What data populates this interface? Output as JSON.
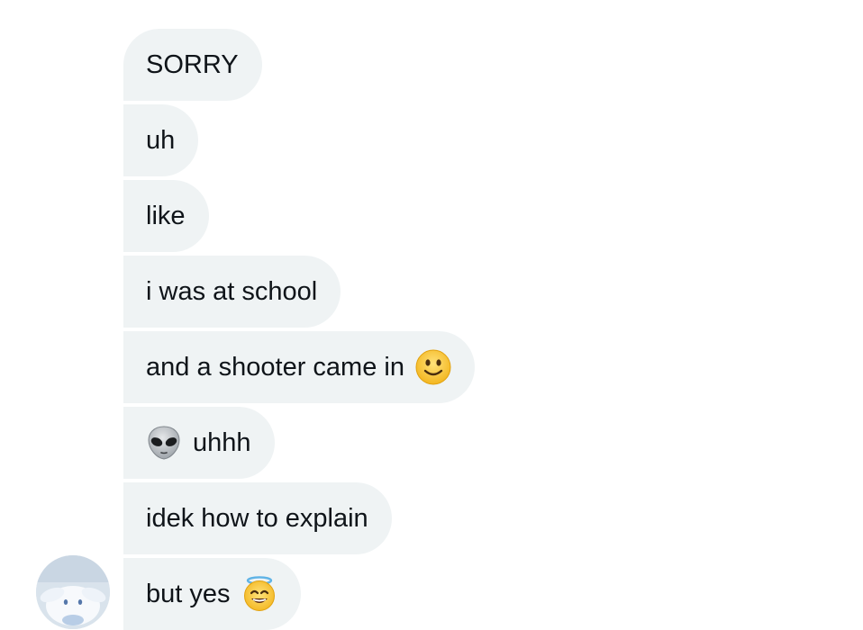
{
  "conversation": {
    "messages": [
      {
        "text": "SORRY",
        "emoji_before": "",
        "emoji_after": ""
      },
      {
        "text": "uh",
        "emoji_before": "",
        "emoji_after": ""
      },
      {
        "text": "like",
        "emoji_before": "",
        "emoji_after": ""
      },
      {
        "text": "i was at school",
        "emoji_before": "",
        "emoji_after": ""
      },
      {
        "text": "and a shooter came in",
        "emoji_before": "",
        "emoji_after": "slightly-smiling-face-icon"
      },
      {
        "text": "uhhh",
        "emoji_before": "alien-icon",
        "emoji_after": ""
      },
      {
        "text": "idek how to explain",
        "emoji_before": "",
        "emoji_after": ""
      },
      {
        "text": "but yes",
        "emoji_before": "",
        "emoji_after": "smiling-face-with-halo-icon"
      }
    ],
    "avatar": "avatar"
  },
  "colors": {
    "bubble_bg": "#eff3f4",
    "text": "#0f1419",
    "background": "#ffffff"
  }
}
